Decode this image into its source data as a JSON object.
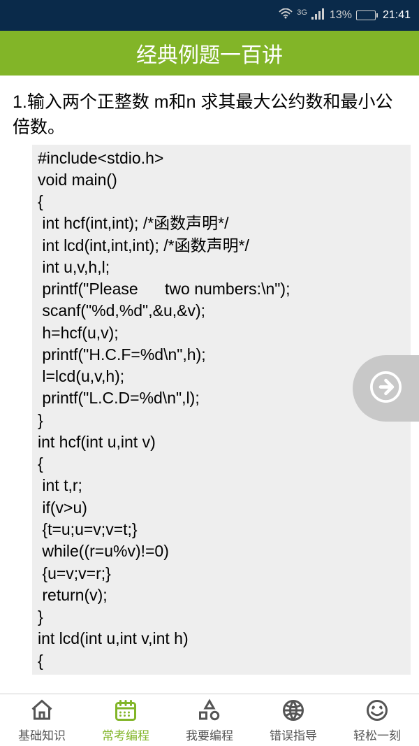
{
  "statusBar": {
    "network": "3G",
    "signal": "●𝗅𝗅",
    "battery": "13%",
    "time": "21:41"
  },
  "titleBar": {
    "title": "经典例题一百讲"
  },
  "content": {
    "problemTitle": "1.输入两个正整数 m和n 求其最大公约数和最小公倍数。",
    "code": "#include<stdio.h>\nvoid main()\n{\n int hcf(int,int); /*函数声明*/\n int lcd(int,int,int); /*函数声明*/\n int u,v,h,l;\n printf(\"Please      two numbers:\\n\");\n scanf(\"%d,%d\",&u,&v);\n h=hcf(u,v);\n printf(\"H.C.F=%d\\n\",h);\n l=lcd(u,v,h);\n printf(\"L.C.D=%d\\n\",l);\n}\nint hcf(int u,int v)\n{\n int t,r;\n if(v>u)\n {t=u;u=v;v=t;}\n while((r=u%v)!=0)\n {u=v;v=r;}\n return(v);\n}\nint lcd(int u,int v,int h)\n{"
  },
  "nav": {
    "items": [
      {
        "label": "基础知识"
      },
      {
        "label": "常考编程"
      },
      {
        "label": "我要编程"
      },
      {
        "label": "错误指导"
      },
      {
        "label": "轻松一刻"
      }
    ]
  }
}
